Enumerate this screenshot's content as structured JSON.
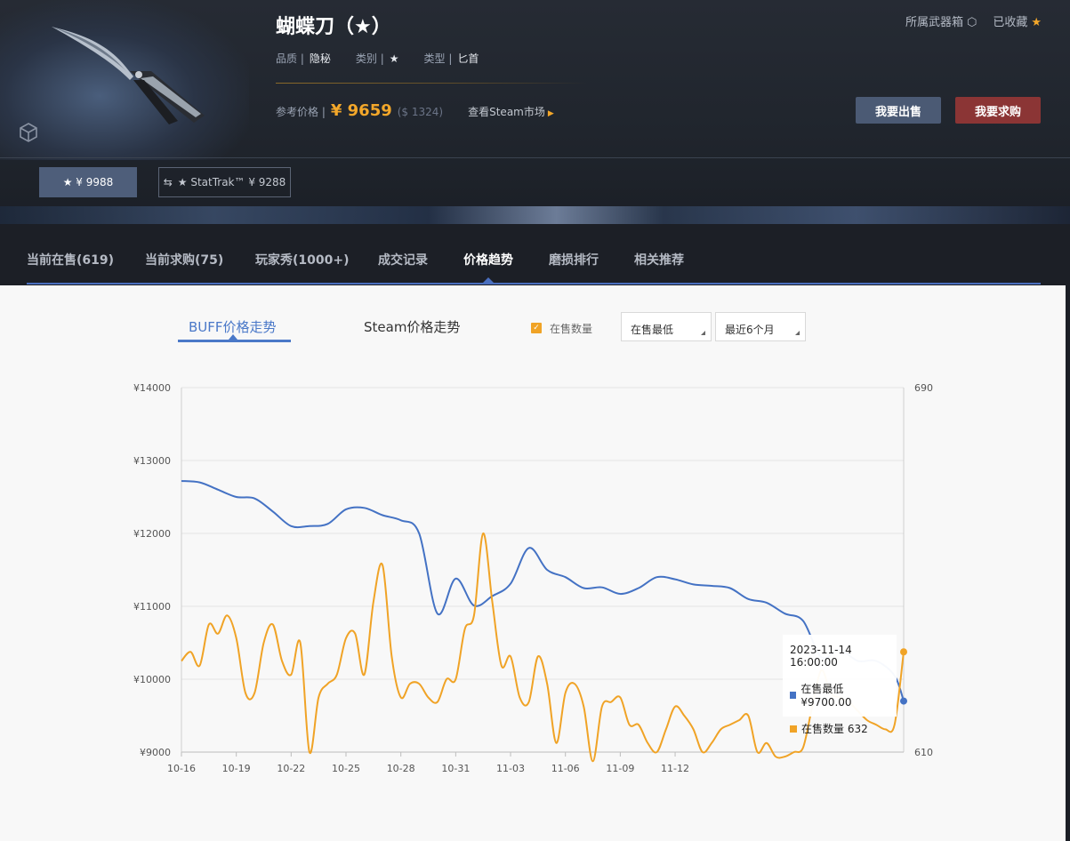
{
  "item": {
    "name": "蝴蝶刀（★）",
    "quality_label": "品质 |",
    "quality_value": "隐秘",
    "category_label": "类别 |",
    "category_value": "★",
    "type_label": "类型 |",
    "type_value": "匕首",
    "ref_price_label": "参考价格 |",
    "ref_price": "¥ 9659",
    "ref_price_usd": "($ 1324)",
    "steam_market_link": "查看Steam市场",
    "weapon_case_link": "所属武器箱",
    "favorited_label": "已收藏",
    "sell_button": "我要出售",
    "buy_button": "我要求购",
    "variant_normal": "★ ¥ 9988",
    "variant_stattrak": "★ StatTrak™ ¥ 9288"
  },
  "tabs": [
    {
      "label": "当前在售(619)"
    },
    {
      "label": "当前求购(75)"
    },
    {
      "label": "玩家秀(1000+)"
    },
    {
      "label": "成交记录"
    },
    {
      "label": "价格趋势"
    },
    {
      "label": "磨损排行"
    },
    {
      "label": "相关推荐"
    }
  ],
  "active_tab": "价格趋势",
  "chart_controls": {
    "buff_tab": "BUFF价格走势",
    "steam_tab": "Steam价格走势",
    "show_count_label": "在售数量",
    "metric_select": "在售最低",
    "range_select": "最近6个月"
  },
  "tooltip": {
    "datetime": "2023-11-14 16:00:00",
    "row1": "在售最低 ¥9700.00",
    "row2": "在售数量 632"
  },
  "colors": {
    "series_min_price": "#4472c4",
    "series_count": "#f0a326",
    "accent_gold": "#f3a72a",
    "accent_blue": "#4a78c8"
  },
  "chart_data": {
    "type": "line",
    "x_start_label": "10-16",
    "x_ticks": [
      "10-16",
      "10-19",
      "10-22",
      "10-25",
      "10-28",
      "10-31",
      "11-03",
      "11-06",
      "11-09",
      "11-12"
    ],
    "y_left_ticks": [
      "¥9000",
      "¥10000",
      "¥11000",
      "¥12000",
      "¥13000",
      "¥14000"
    ],
    "y_left_range": [
      9000,
      14000
    ],
    "y_right_ticks": [
      "610",
      "690"
    ],
    "y_right_range": [
      610,
      690
    ],
    "series": [
      {
        "name": "在售最低",
        "axis": "left",
        "x_days": [
          0,
          1,
          2,
          3,
          4,
          5,
          6,
          7,
          8,
          9,
          10,
          11,
          12,
          13,
          14,
          15,
          16,
          17,
          18,
          19,
          20,
          21,
          22,
          23,
          24,
          25,
          26,
          27,
          28,
          29,
          30,
          31,
          32,
          33,
          34,
          35,
          36,
          37,
          38,
          39,
          39.5
        ],
        "values": [
          12720,
          12700,
          12600,
          12500,
          12480,
          12300,
          12100,
          12100,
          12130,
          12330,
          12350,
          12250,
          12180,
          12000,
          10900,
          11380,
          11010,
          11140,
          11310,
          11800,
          11500,
          11400,
          11250,
          11260,
          11170,
          11250,
          11400,
          11370,
          11300,
          11280,
          11250,
          11100,
          11050,
          10900,
          10800,
          10300,
          10400,
          10250,
          10250,
          10050,
          9700
        ]
      },
      {
        "name": "在售数量",
        "axis": "right",
        "x_days": [
          0,
          0.5,
          1,
          1.5,
          2,
          2.5,
          3,
          3.5,
          4,
          4.5,
          5,
          5.5,
          6,
          6.5,
          7,
          7.5,
          8,
          8.5,
          9,
          9.5,
          10,
          10.5,
          11,
          11.5,
          12,
          12.5,
          13,
          13.5,
          14,
          14.5,
          15,
          15.5,
          16,
          16.5,
          17,
          17.5,
          18,
          18.5,
          19,
          19.5,
          20,
          20.5,
          21,
          21.5,
          22,
          22.5,
          23,
          23.5,
          24,
          24.5,
          25,
          25.5,
          26,
          26.5,
          27,
          27.5,
          28,
          28.5,
          29,
          29.5,
          30,
          30.5,
          31,
          31.5,
          32,
          32.5,
          33,
          33.5,
          34,
          34.5,
          35,
          35.5,
          36,
          36.5,
          37,
          37.5,
          38,
          38.5,
          39,
          39.5
        ],
        "values": [
          630,
          632,
          629,
          638,
          636,
          640,
          635,
          623,
          623,
          634,
          638,
          630,
          627,
          634,
          610,
          622,
          625,
          627,
          635,
          636,
          627,
          643,
          651,
          631,
          622,
          625,
          625,
          622,
          621,
          626,
          626,
          637,
          640,
          658,
          643,
          629,
          631,
          622,
          621,
          631,
          625,
          612,
          623,
          625,
          620,
          608,
          620,
          621,
          622,
          616,
          616,
          612,
          610,
          615,
          620,
          618,
          615,
          610,
          612,
          615,
          616,
          617,
          618,
          610,
          612,
          609,
          609,
          610,
          611,
          620,
          628,
          623,
          622,
          621,
          619,
          617,
          616,
          615,
          616,
          632
        ]
      }
    ],
    "tooltip_point": {
      "x": "2023-11-14 16:00:00",
      "min_price": 9700,
      "count": 632
    },
    "grid": true,
    "legend": "none"
  }
}
